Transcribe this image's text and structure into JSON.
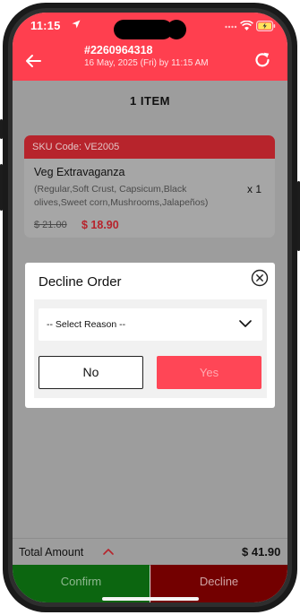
{
  "status_bar": {
    "time": "11:15"
  },
  "header": {
    "order_number": "#2260964318",
    "order_datetime": "16 May, 2025 (Fri) by 11:15 AM"
  },
  "items_title": "1 ITEM",
  "item": {
    "sku": "SKU Code: VE2005",
    "name": "Veg Extravaganza",
    "description": "(Regular,Soft Crust, Capsicum,Black olives,Sweet corn,Mushrooms,Jalapeños)",
    "quantity": "x 1",
    "original_price": "$ 21.00",
    "price": "$ 18.90"
  },
  "dialog": {
    "title": "Decline Order",
    "select_placeholder": "-- Select Reason --",
    "no_label": "No",
    "yes_label": "Yes"
  },
  "total": {
    "label": "Total Amount",
    "value": "$ 41.90"
  },
  "actions": {
    "confirm_label": "Confirm",
    "decline_label": "Decline"
  },
  "colors": {
    "header_red": "#ff3f4f",
    "sku_bar": "#b7242c",
    "confirm_green": "#0c6610",
    "decline_dark_red": "#730000"
  }
}
